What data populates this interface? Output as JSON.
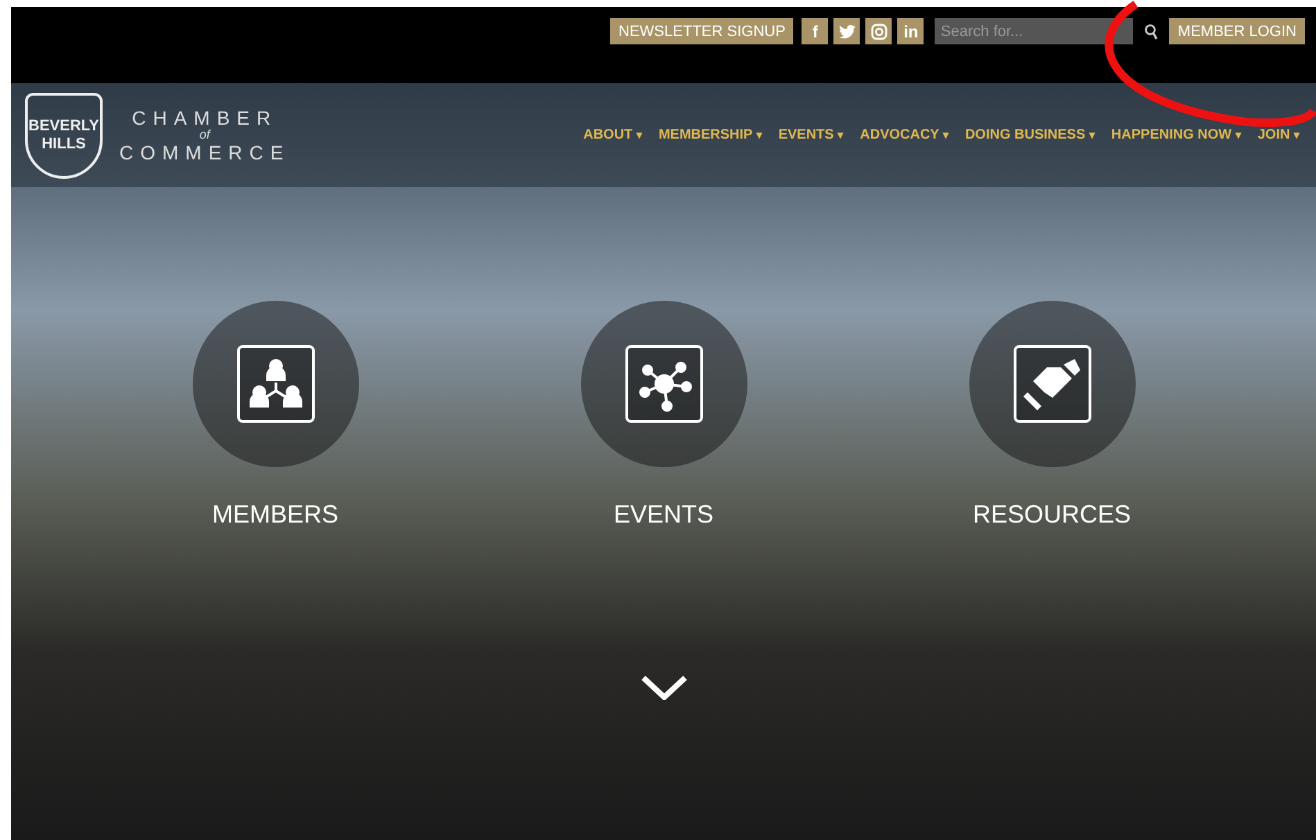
{
  "top_bar": {
    "newsletter": "NEWSLETTER SIGNUP",
    "social": [
      {
        "kind": "facebook",
        "label": "f"
      },
      {
        "kind": "twitter"
      },
      {
        "kind": "instagram"
      },
      {
        "kind": "linkedin",
        "label": "in"
      }
    ],
    "search": {
      "placeholder": "Search for..."
    },
    "login": "MEMBER LOGIN"
  },
  "logo": {
    "badge": [
      "BEVERLY",
      "HILLS"
    ],
    "line1": "CHAMBER",
    "joiner": "of",
    "line2": "COMMERCE"
  },
  "nav": [
    {
      "label": "ABOUT",
      "arrow": "▾"
    },
    {
      "label": "MEMBERSHIP",
      "arrow": "▾"
    },
    {
      "label": "EVENTS",
      "arrow": "▾"
    },
    {
      "label": "ADVOCACY",
      "arrow": "▾"
    },
    {
      "label": "DOING BUSINESS",
      "arrow": "▾"
    },
    {
      "label": "HAPPENING NOW",
      "arrow": "▾"
    },
    {
      "label": "JOIN",
      "arrow": "▾"
    }
  ],
  "features": [
    {
      "kind": "members",
      "label": "MEMBERS"
    },
    {
      "kind": "events",
      "label": "EVENTS"
    },
    {
      "kind": "resources",
      "label": "RESOURCES"
    }
  ],
  "annotation": {
    "kind": "circle",
    "color": "#ee1111"
  }
}
